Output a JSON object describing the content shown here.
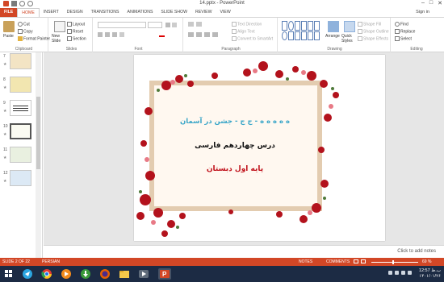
{
  "window": {
    "title": "14.pptx - PowerPoint",
    "minimize": "–",
    "maximize": "□",
    "close": "✕"
  },
  "tabs": [
    "FILE",
    "HOME",
    "INSERT",
    "DESIGN",
    "TRANSITIONS",
    "ANIMATIONS",
    "SLIDE SHOW",
    "REVIEW",
    "VIEW"
  ],
  "signin": "Sign in",
  "ribbon": {
    "clipboard": {
      "label": "Clipboard",
      "paste": "Paste",
      "cut": "Cut",
      "copy": "Copy",
      "format_painter": "Format Painter"
    },
    "slides": {
      "label": "Slides",
      "new_slide": "New Slide",
      "layout": "Layout",
      "reset": "Reset",
      "section": "Section"
    },
    "font": {
      "label": "Font"
    },
    "paragraph": {
      "label": "Paragraph",
      "text_direction": "Text Direction",
      "align_text": "Align Text",
      "convert_smartart": "Convert to SmartArt"
    },
    "drawing": {
      "label": "Drawing",
      "arrange": "Arrange",
      "quick_styles": "Quick Styles",
      "shape_fill": "Shape Fill",
      "shape_outline": "Shape Outline",
      "shape_effects": "Shape Effects"
    },
    "editing": {
      "label": "Editing",
      "find": "Find",
      "replace": "Replace",
      "select": "Select"
    }
  },
  "thumbnails": [
    {
      "num": "7",
      "color": "#f3e4c4"
    },
    {
      "num": "8",
      "color": "#f2e6b0"
    },
    {
      "num": "9",
      "color": "#ffffff"
    },
    {
      "num": "10",
      "color": "#fbfbf2"
    },
    {
      "num": "11",
      "color": "#e9f0e0"
    },
    {
      "num": "12",
      "color": "#dce9f5"
    }
  ],
  "slide": {
    "line1": "ه ه ه ه ه - ج ج - جشن در آسمان",
    "line2": "درس چهاردهم فارسی",
    "line3": "پایه اول دبستان"
  },
  "notes_placeholder": "Click to add notes",
  "status": {
    "slide_count": "SLIDE 2 OF 22",
    "language": "PERSIAN",
    "notes": "NOTES",
    "comments": "COMMENTS",
    "zoom": "69 %"
  },
  "taskbar": {
    "time": "12:57 ب.ظ",
    "date": "۱۴۰۱/۰۱/۲۶"
  }
}
